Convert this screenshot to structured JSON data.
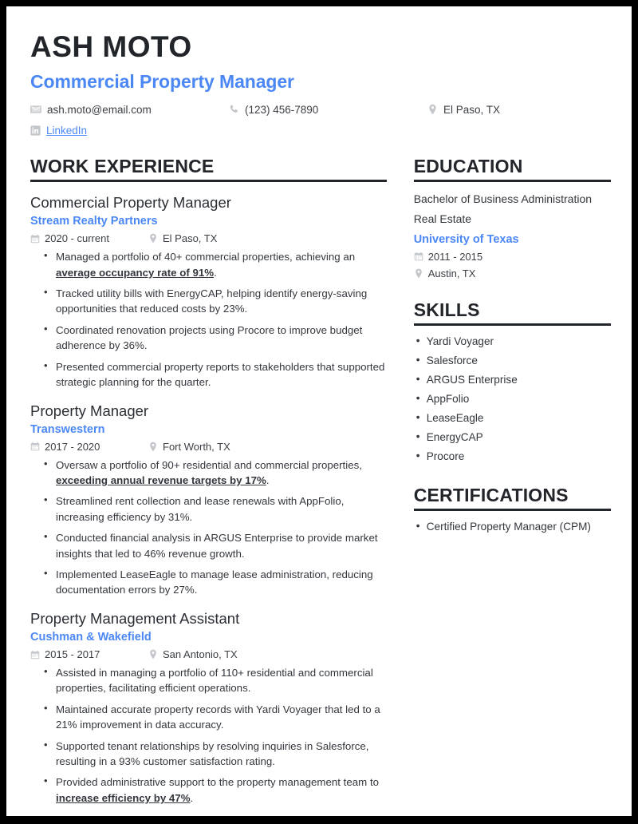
{
  "theme": {
    "accent": "#4b88f5",
    "ink": "#22252a",
    "body_text": "#33373d",
    "icon_gray": "#c3c6cb",
    "page_bg": "#ffffff",
    "frame": "#000000"
  },
  "header": {
    "name": "ASH MOTO",
    "headline": "Commercial Property Manager",
    "contacts": [
      {
        "icon": "envelope-icon",
        "label": "ash.moto@email.com",
        "kind": "email"
      },
      {
        "icon": "phone-icon",
        "label": "(123) 456-7890",
        "kind": "phone"
      },
      {
        "icon": "location-pin-icon",
        "label": "El Paso, TX",
        "kind": "location"
      },
      {
        "icon": "linkedin-icon",
        "label": "LinkedIn",
        "kind": "link"
      }
    ]
  },
  "work": {
    "title": "WORK EXPERIENCE",
    "entries": [
      {
        "role": "Commercial Property Manager",
        "org": "Stream Realty Partners",
        "dates": "2020 - current",
        "location": "El Paso, TX",
        "bullets": [
          {
            "pre": "Managed a portfolio of 40+ commercial properties, achieving an ",
            "strong": "average occupancy rate of 91%",
            "post": "."
          },
          {
            "pre": "Tracked utility bills with EnergyCAP, helping identify energy-saving opportunities that reduced costs by 23%.",
            "strong": "",
            "post": ""
          },
          {
            "pre": "Coordinated renovation projects using Procore to improve budget adherence by 36%.",
            "strong": "",
            "post": ""
          },
          {
            "pre": "Presented commercial property reports to stakeholders that supported strategic planning for the quarter.",
            "strong": "",
            "post": ""
          }
        ]
      },
      {
        "role": "Property Manager",
        "org": "Transwestern",
        "dates": "2017 - 2020",
        "location": "Fort Worth, TX",
        "bullets": [
          {
            "pre": "Oversaw a portfolio of 90+ residential and commercial properties, ",
            "strong": "exceeding annual revenue targets by 17%",
            "post": "."
          },
          {
            "pre": "Streamlined rent collection and lease renewals with AppFolio, increasing efficiency by 31%.",
            "strong": "",
            "post": ""
          },
          {
            "pre": "Conducted financial analysis in ARGUS Enterprise to provide market insights that led to 46% revenue growth.",
            "strong": "",
            "post": ""
          },
          {
            "pre": "Implemented LeaseEagle to manage lease administration, reducing documentation errors by 27%.",
            "strong": "",
            "post": ""
          }
        ]
      },
      {
        "role": "Property Management Assistant",
        "org": "Cushman & Wakefield",
        "dates": "2015 - 2017",
        "location": "San Antonio, TX",
        "bullets": [
          {
            "pre": "Assisted in managing a portfolio of 110+ residential and commercial properties, facilitating efficient operations.",
            "strong": "",
            "post": ""
          },
          {
            "pre": "Maintained accurate property records with Yardi Voyager that led to a 21% improvement in data accuracy.",
            "strong": "",
            "post": ""
          },
          {
            "pre": "Supported tenant relationships by resolving inquiries in Salesforce, resulting in a 93% customer satisfaction rating.",
            "strong": "",
            "post": ""
          },
          {
            "pre": "Provided administrative support to the property management team to ",
            "strong": "increase efficiency by 47%",
            "post": "."
          }
        ]
      }
    ]
  },
  "education": {
    "title": "EDUCATION",
    "degree": "Bachelor of Business Administration",
    "field": "Real Estate",
    "school": "University of Texas",
    "dates": "2011 - 2015",
    "location": "Austin, TX"
  },
  "skills": {
    "title": "SKILLS",
    "items": [
      "Yardi Voyager",
      "Salesforce",
      "ARGUS Enterprise",
      "AppFolio",
      "LeaseEagle",
      "EnergyCAP",
      "Procore"
    ]
  },
  "certifications": {
    "title": "CERTIFICATIONS",
    "items": [
      "Certified Property Manager (CPM)"
    ]
  }
}
